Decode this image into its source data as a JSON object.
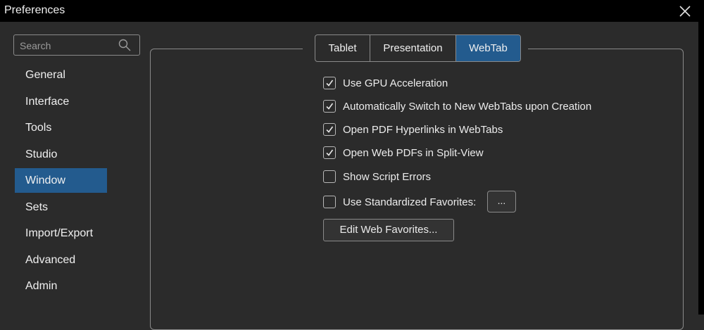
{
  "window": {
    "title": "Preferences"
  },
  "search": {
    "placeholder": "Search"
  },
  "sidebar": {
    "items": [
      {
        "label": "General"
      },
      {
        "label": "Interface"
      },
      {
        "label": "Tools"
      },
      {
        "label": "Studio"
      },
      {
        "label": "Window",
        "active": true
      },
      {
        "label": "Sets"
      },
      {
        "label": "Import/Export"
      },
      {
        "label": "Advanced"
      },
      {
        "label": "Admin"
      }
    ]
  },
  "tabs": [
    {
      "label": "Tablet"
    },
    {
      "label": "Presentation"
    },
    {
      "label": "WebTab",
      "active": true
    }
  ],
  "options": [
    {
      "label": "Use GPU Acceleration",
      "checked": true
    },
    {
      "label": "Automatically Switch to New WebTabs upon Creation",
      "checked": true
    },
    {
      "label": "Open PDF Hyperlinks in WebTabs",
      "checked": true
    },
    {
      "label": "Open Web PDFs in Split-View",
      "checked": true
    },
    {
      "label": "Show Script Errors",
      "checked": false
    },
    {
      "label": "Use Standardized Favorites:",
      "checked": false
    }
  ],
  "buttons": {
    "browse_label": "...",
    "edit_favorites_label": "Edit Web Favorites..."
  },
  "colors": {
    "accent": "#235b8e",
    "background": "#2b2b2b",
    "titlebar": "#000000"
  }
}
